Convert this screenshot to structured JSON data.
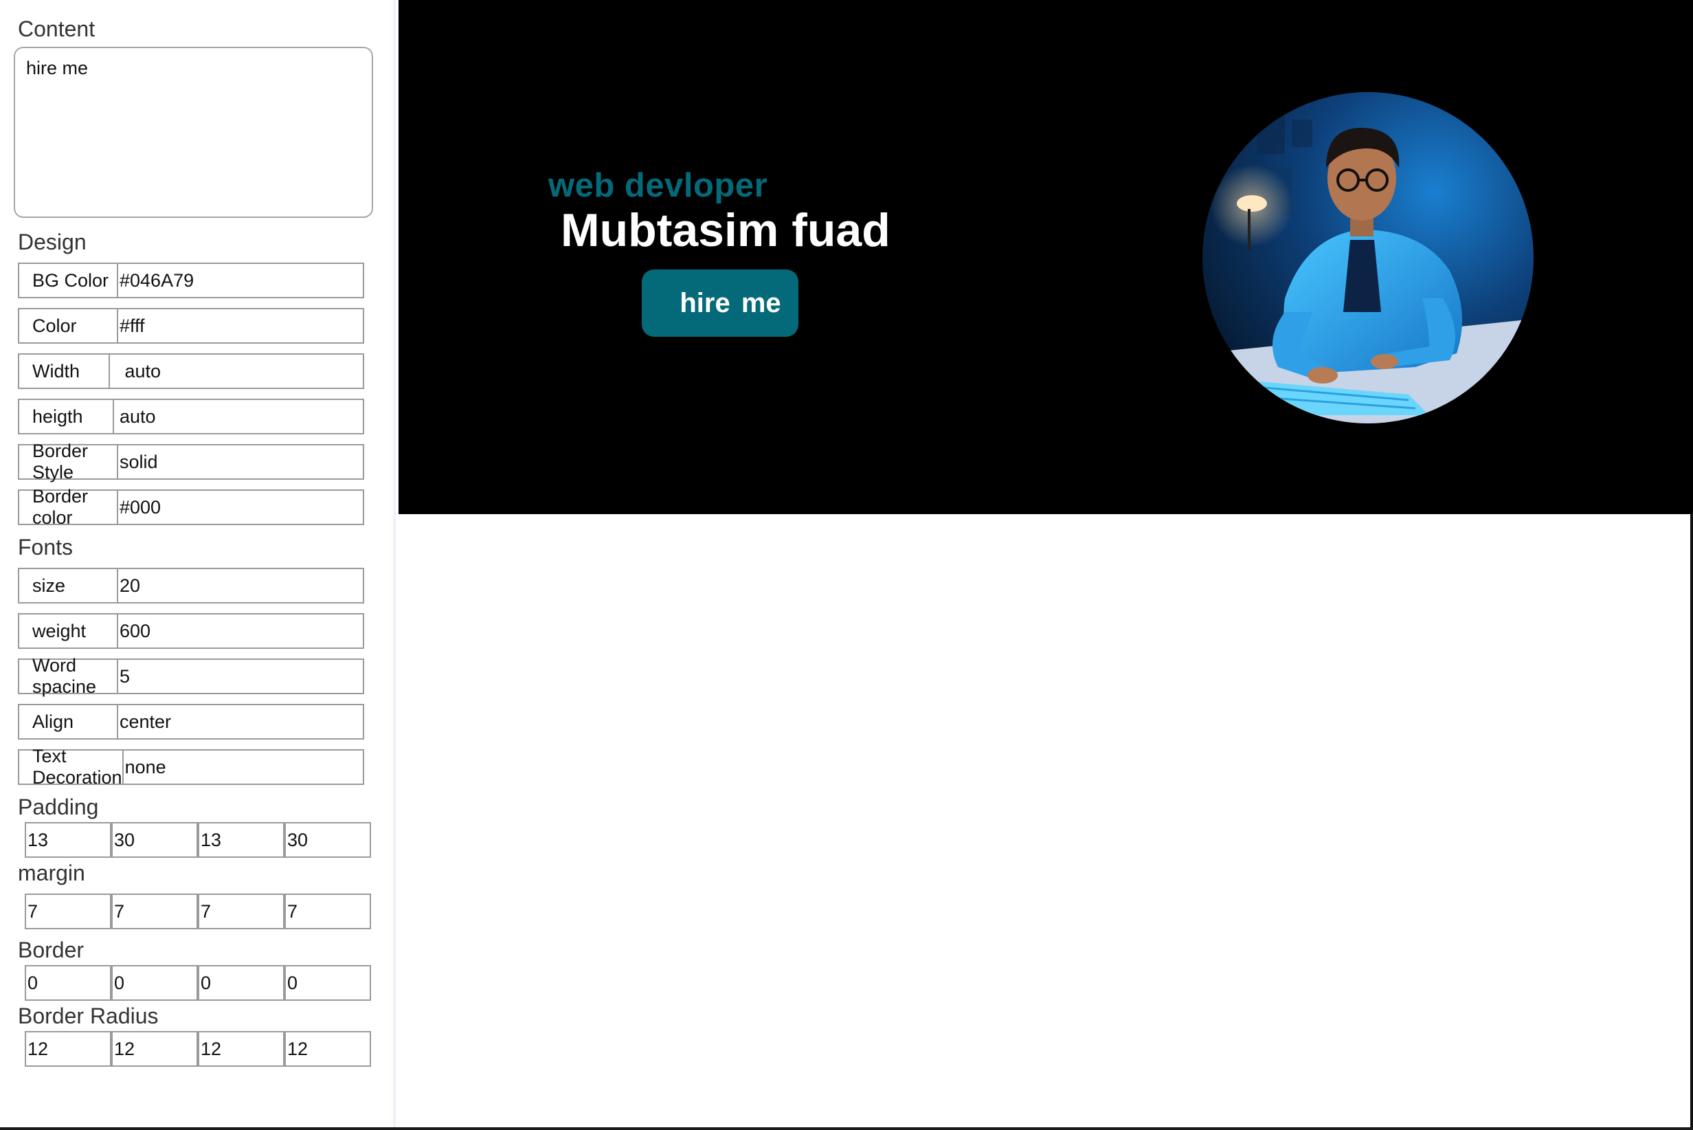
{
  "sidebar": {
    "content": {
      "title": "Content",
      "value": "hire me"
    },
    "design": {
      "title": "Design",
      "rows": [
        {
          "label": "BG Color",
          "value": "#046A79"
        },
        {
          "label": "Color",
          "value": "#fff"
        },
        {
          "label": "Width",
          "value": " auto"
        },
        {
          "label": "heigth",
          "value": "auto"
        },
        {
          "label": "Border Style",
          "value": "solid"
        },
        {
          "label": "Border color",
          "value": "#000"
        }
      ]
    },
    "fonts": {
      "title": "Fonts",
      "rows": [
        {
          "label": "size",
          "value": "20"
        },
        {
          "label": "weight",
          "value": "600"
        },
        {
          "label": "Word spacine",
          "value": "5"
        },
        {
          "label": "Align",
          "value": "center"
        },
        {
          "label": "Text Decoration",
          "value": "none"
        }
      ]
    },
    "padding": {
      "title": "Padding",
      "values": [
        "13",
        "30",
        "13",
        "30"
      ]
    },
    "margin": {
      "title": "margin",
      "values": [
        "7",
        "7",
        "7",
        "7"
      ]
    },
    "border": {
      "title": "Border",
      "values": [
        "0",
        "0",
        "0",
        "0"
      ]
    },
    "radius": {
      "title": "Border Radius",
      "values": [
        "12",
        "12",
        "12",
        "12"
      ]
    }
  },
  "preview": {
    "subtitle": "web devloper",
    "title": "Mubtasim fuad",
    "button_label": "hire me",
    "accent": "#046A79",
    "avatar_icon": "developer-portrait"
  }
}
